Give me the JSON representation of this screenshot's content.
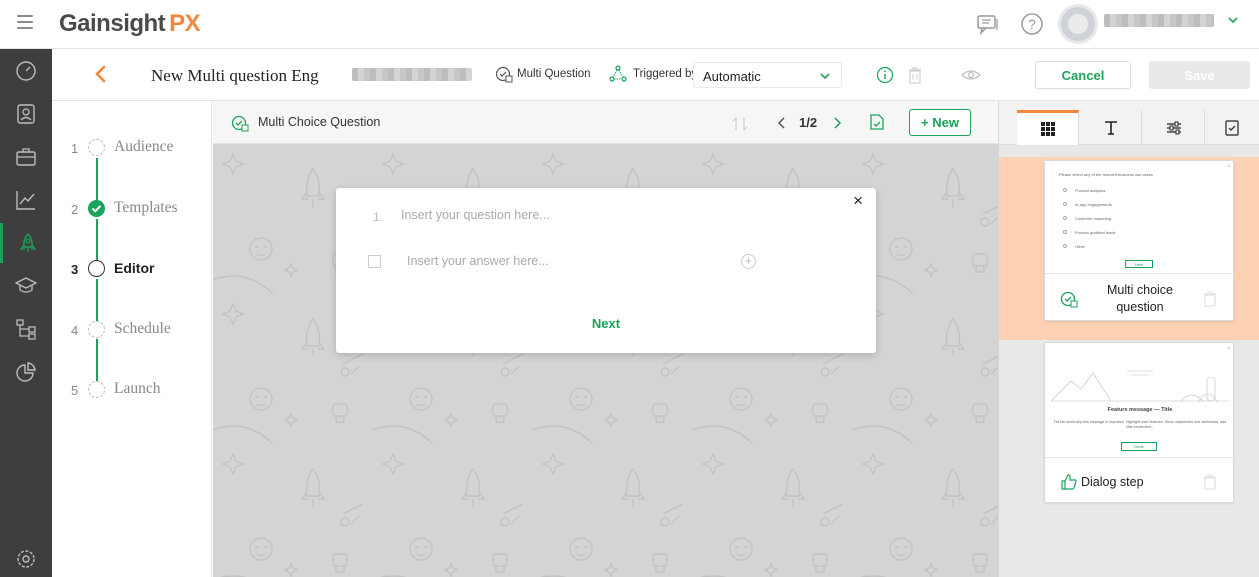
{
  "app": {
    "brand_name": "Gainsight",
    "brand_suffix": "PX",
    "brand_color": "#f5873a",
    "accent_color": "#1aa35a"
  },
  "topbar": {
    "icons": [
      "menu-icon",
      "chat-icon",
      "help-icon",
      "avatar",
      "chevron-down-icon"
    ]
  },
  "leftnav": {
    "items": [
      "dashboard-icon",
      "user-profile-icon",
      "briefcase-icon",
      "analytics-icon",
      "rocket-icon",
      "graduation-cap-icon",
      "hierarchy-icon",
      "pie-chart-icon",
      "settings-icon"
    ],
    "active_item": "rocket-icon"
  },
  "editor_header": {
    "title": "New Multi question Eng",
    "type_label": "Multi Question",
    "triggered_label": "Triggered by",
    "trigger_value": "Automatic",
    "cancel_label": "Cancel",
    "save_label": "Save"
  },
  "steps": [
    {
      "num": "1",
      "label": "Audience",
      "state": "pending"
    },
    {
      "num": "2",
      "label": "Templates",
      "state": "done"
    },
    {
      "num": "3",
      "label": "Editor",
      "state": "current"
    },
    {
      "num": "4",
      "label": "Schedule",
      "state": "pending"
    },
    {
      "num": "5",
      "label": "Launch",
      "state": "pending"
    }
  ],
  "canvas_header": {
    "step_label": "Multi Choice Question",
    "page_indicator": "1/2",
    "new_label": "+ New"
  },
  "dialog": {
    "close": "×",
    "question_number": "1.",
    "question_placeholder": "Insert your question here...",
    "answer_placeholder": "Insert your answer here...",
    "next_label": "Next"
  },
  "right_panel": {
    "tabs": [
      "grid-icon",
      "text-icon",
      "sliders-icon",
      "survey-icon"
    ],
    "active_tab": "grid-icon",
    "cards": [
      {
        "caption": "Multi choice question",
        "active": true,
        "preview": {
          "question": "Please select any of the relevant business use cases",
          "options": [
            "Product analytics",
            "In-app engagements",
            "Customer marketing",
            "Product qualified leads",
            "Other"
          ],
          "button": "Next"
        }
      },
      {
        "caption": "Dialog step",
        "active": false,
        "preview": {
          "title": "Feature message — Title",
          "body": "Tell the world why this message is important. Highlight main features. Show uniqueness and usefulness, add little excitement...",
          "button": "Done"
        }
      }
    ]
  }
}
